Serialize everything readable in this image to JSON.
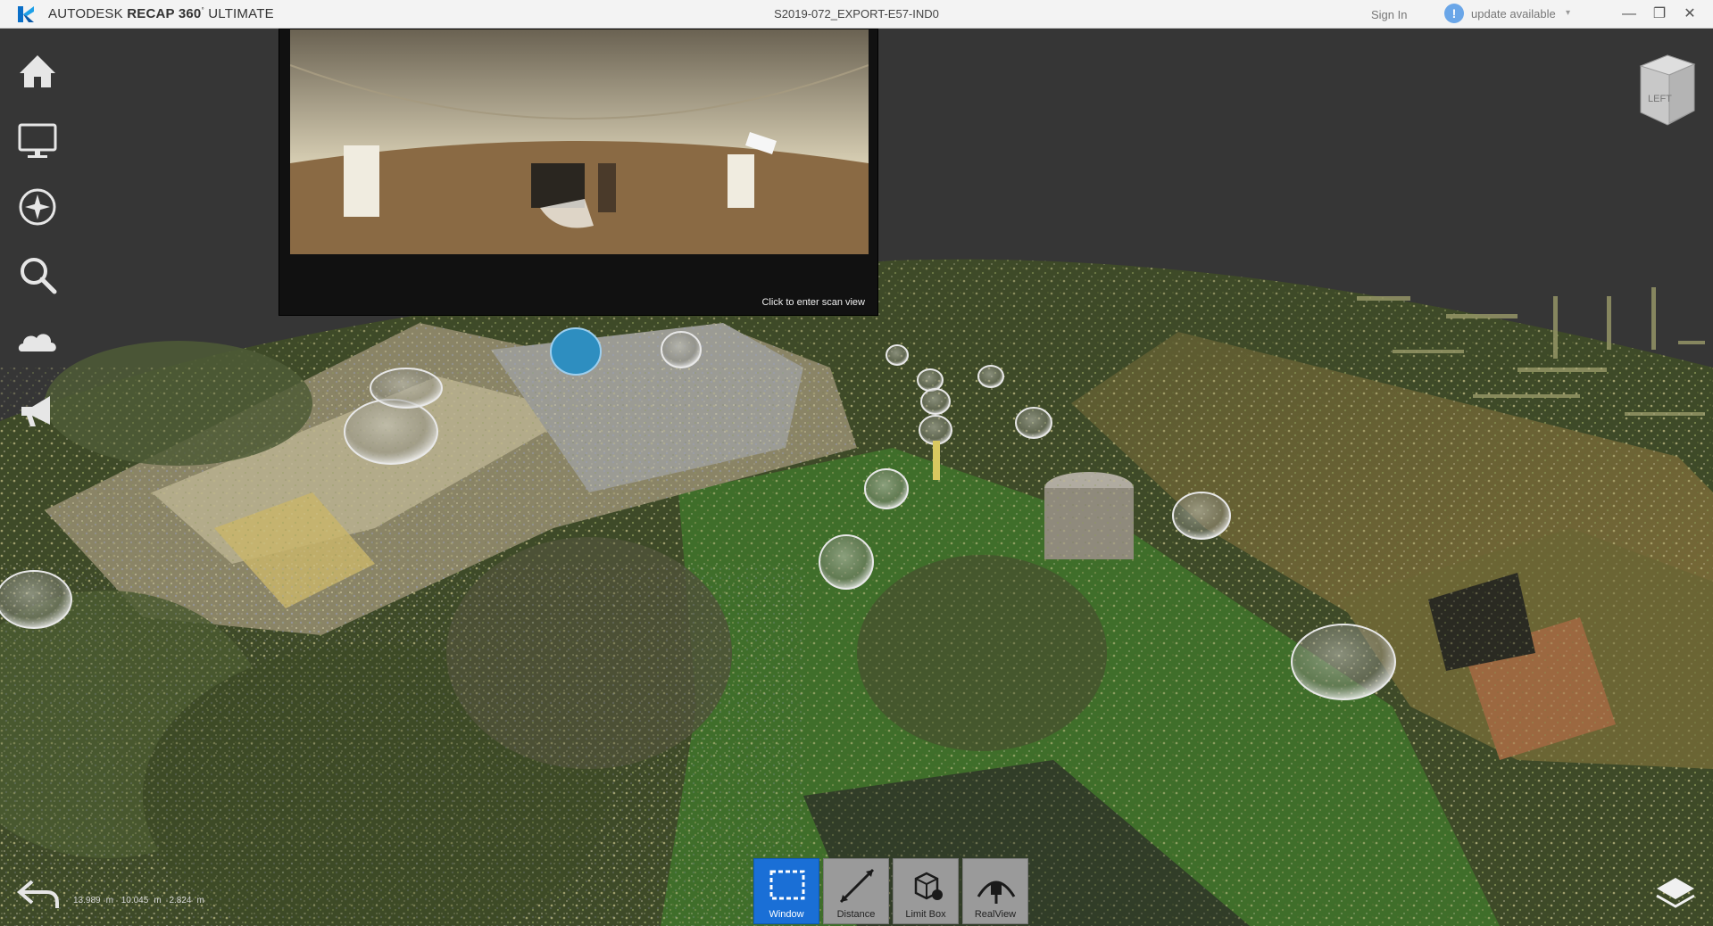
{
  "titlebar": {
    "brand_prefix": "AUTODESK",
    "brand_product": "RECAP 360",
    "brand_suffix": "ULTIMATE",
    "document": "S2019-072_EXPORT-E57-IND0",
    "sign_in": "Sign In",
    "update": "update available"
  },
  "preview": {
    "hint": "Click to enter scan view"
  },
  "viewcube": {
    "face_label": "LEFT"
  },
  "toolbar": {
    "tools": [
      {
        "label": "Window",
        "active": true
      },
      {
        "label": "Distance",
        "active": false
      },
      {
        "label": "Limit Box",
        "active": false
      },
      {
        "label": "RealView",
        "active": false
      }
    ]
  },
  "status": {
    "x": "13.989",
    "y": "10.045",
    "z": "2.824",
    "unit": "m"
  },
  "colors": {
    "background": "#363636",
    "accent": "#1a6fd6",
    "titlebar": "#f3f3f3"
  }
}
